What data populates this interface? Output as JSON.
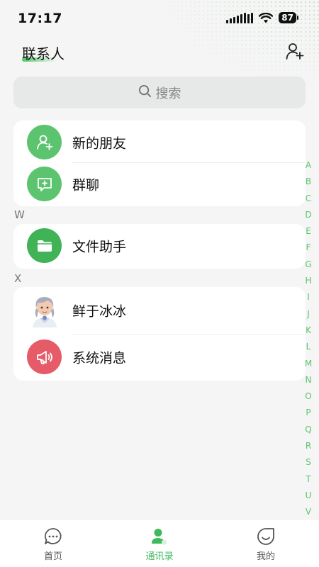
{
  "status": {
    "time": "17:17",
    "battery": "87"
  },
  "header": {
    "title": "联系人",
    "add_icon": "add-friend-icon"
  },
  "search": {
    "placeholder": "搜索",
    "icon": "search-icon"
  },
  "functions": [
    {
      "label": "新的朋友",
      "icon": "new-friend-icon",
      "color": "#5cc46e"
    },
    {
      "label": "群聊",
      "icon": "group-chat-icon",
      "color": "#5cc46e"
    }
  ],
  "sections": [
    {
      "letter": "W",
      "contacts": [
        {
          "label": "文件助手",
          "icon": "folder-icon",
          "color": "#3fb356"
        }
      ]
    },
    {
      "letter": "X",
      "contacts": [
        {
          "label": "鲜于冰冰",
          "icon": "avatar"
        },
        {
          "label": "系统消息",
          "icon": "megaphone-icon",
          "color": "#e65b68"
        }
      ]
    }
  ],
  "index_letters": [
    "A",
    "B",
    "C",
    "D",
    "E",
    "F",
    "G",
    "H",
    "I",
    "J",
    "K",
    "L",
    "M",
    "N",
    "O",
    "P",
    "Q",
    "R",
    "S",
    "T",
    "U",
    "V"
  ],
  "tabs": [
    {
      "label": "首页",
      "icon": "chat-bubble-icon",
      "active": false
    },
    {
      "label": "通讯录",
      "icon": "contacts-icon",
      "active": true
    },
    {
      "label": "我的",
      "icon": "smile-icon",
      "active": false
    }
  ],
  "colors": {
    "accent": "#3fb85a",
    "index": "#5ec46e",
    "background": "#f4f5f4"
  }
}
